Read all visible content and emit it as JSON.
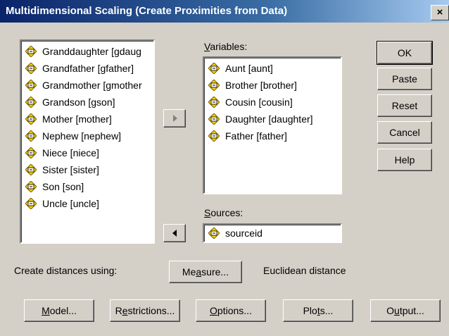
{
  "window": {
    "title": "Multidimensional Scaling (Create Proximities from Data)",
    "close_label": "×"
  },
  "source_list": {
    "items": [
      "Granddaughter [gdaug",
      "Grandfather [gfather]",
      "Grandmother [gmother",
      "Grandson [gson]",
      "Mother [mother]",
      "Nephew [nephew]",
      "Niece [niece]",
      "Sister [sister]",
      "Son [son]",
      "Uncle [uncle]"
    ]
  },
  "variables": {
    "label_ul": "V",
    "label_rest": "ariables:",
    "items": [
      "Aunt [aunt]",
      "Brother [brother]",
      "Cousin [cousin]",
      "Daughter [daughter]",
      "Father [father]"
    ]
  },
  "sources": {
    "label_ul": "S",
    "label_rest": "ources:",
    "value": "sourceid"
  },
  "side_buttons": {
    "ok": "OK",
    "paste": "Paste",
    "reset": "Reset",
    "cancel": "Cancel",
    "help": "Help"
  },
  "distance": {
    "label": "Create distances using:",
    "measure_pre": "Me",
    "measure_ul": "a",
    "measure_post": "sure...",
    "value": "Euclidean distance"
  },
  "bottom_buttons": {
    "model_ul": "M",
    "model_rest": "odel...",
    "restrictions_pre": "R",
    "restrictions_ul": "e",
    "restrictions_rest": "strictions...",
    "options_ul": "O",
    "options_rest": "ptions...",
    "plots_pre": "Plo",
    "plots_ul": "t",
    "plots_rest": "s...",
    "output_pre": "O",
    "output_ul": "u",
    "output_rest": "tput..."
  },
  "colors": {
    "titlebar_start": "#0a246a",
    "titlebar_end": "#a6caf0",
    "dialog_bg": "#d4d0c8",
    "icon_yellow": "#f0d000"
  }
}
